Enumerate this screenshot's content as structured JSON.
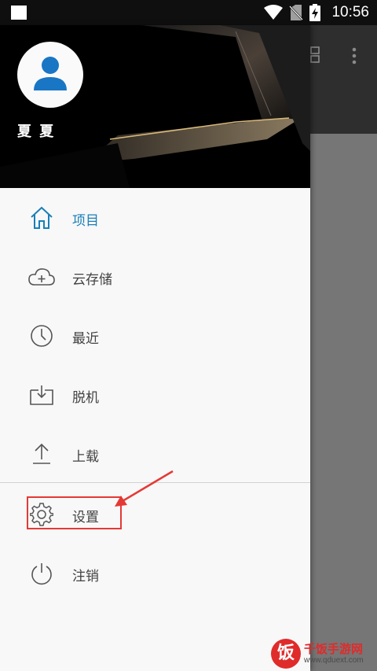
{
  "status_bar": {
    "time": "10:56",
    "icons": [
      "wifi-icon",
      "no-sim-icon",
      "battery-charging-icon"
    ]
  },
  "drawer": {
    "user_name": "夏 夏",
    "avatar_icon": "person-icon",
    "items": [
      {
        "label": "项目",
        "icon": "home-icon",
        "active": true
      },
      {
        "label": "云存储",
        "icon": "cloud-add-icon",
        "active": false
      },
      {
        "label": "最近",
        "icon": "clock-icon",
        "active": false
      },
      {
        "label": "脱机",
        "icon": "download-box-icon",
        "active": false
      },
      {
        "label": "上载",
        "icon": "upload-icon",
        "active": false
      },
      {
        "label": "设置",
        "icon": "gear-icon",
        "active": false
      },
      {
        "label": "注销",
        "icon": "power-icon",
        "active": false
      }
    ]
  },
  "background_app": {
    "icons": [
      "grid-view-icon",
      "more-vert-icon"
    ]
  },
  "annotation": {
    "highlighted_item": "设置",
    "color": "#e53935"
  },
  "watermark": {
    "logo_char": "饭",
    "name": "千饭手游网",
    "url": "www.qduext.com"
  },
  "colors": {
    "accent": "#1a7fb8",
    "text": "#424242",
    "drawer_bg": "#f8f8f8",
    "header_bg": "#000000"
  }
}
